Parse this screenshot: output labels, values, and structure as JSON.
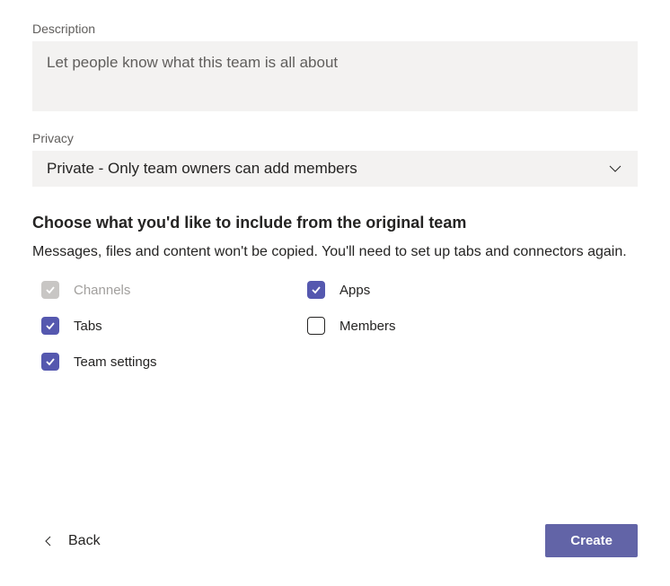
{
  "description": {
    "label": "Description",
    "placeholder": "Let people know what this team is all about"
  },
  "privacy": {
    "label": "Privacy",
    "selected": "Private - Only team owners can add members"
  },
  "includeSection": {
    "heading": "Choose what you'd like to include from the original team",
    "subtext": "Messages, files and content won't be copied. You'll need to set up tabs and connectors again."
  },
  "checkboxes": {
    "channels": "Channels",
    "apps": "Apps",
    "tabs": "Tabs",
    "members": "Members",
    "teamSettings": "Team settings"
  },
  "footer": {
    "back": "Back",
    "create": "Create"
  }
}
